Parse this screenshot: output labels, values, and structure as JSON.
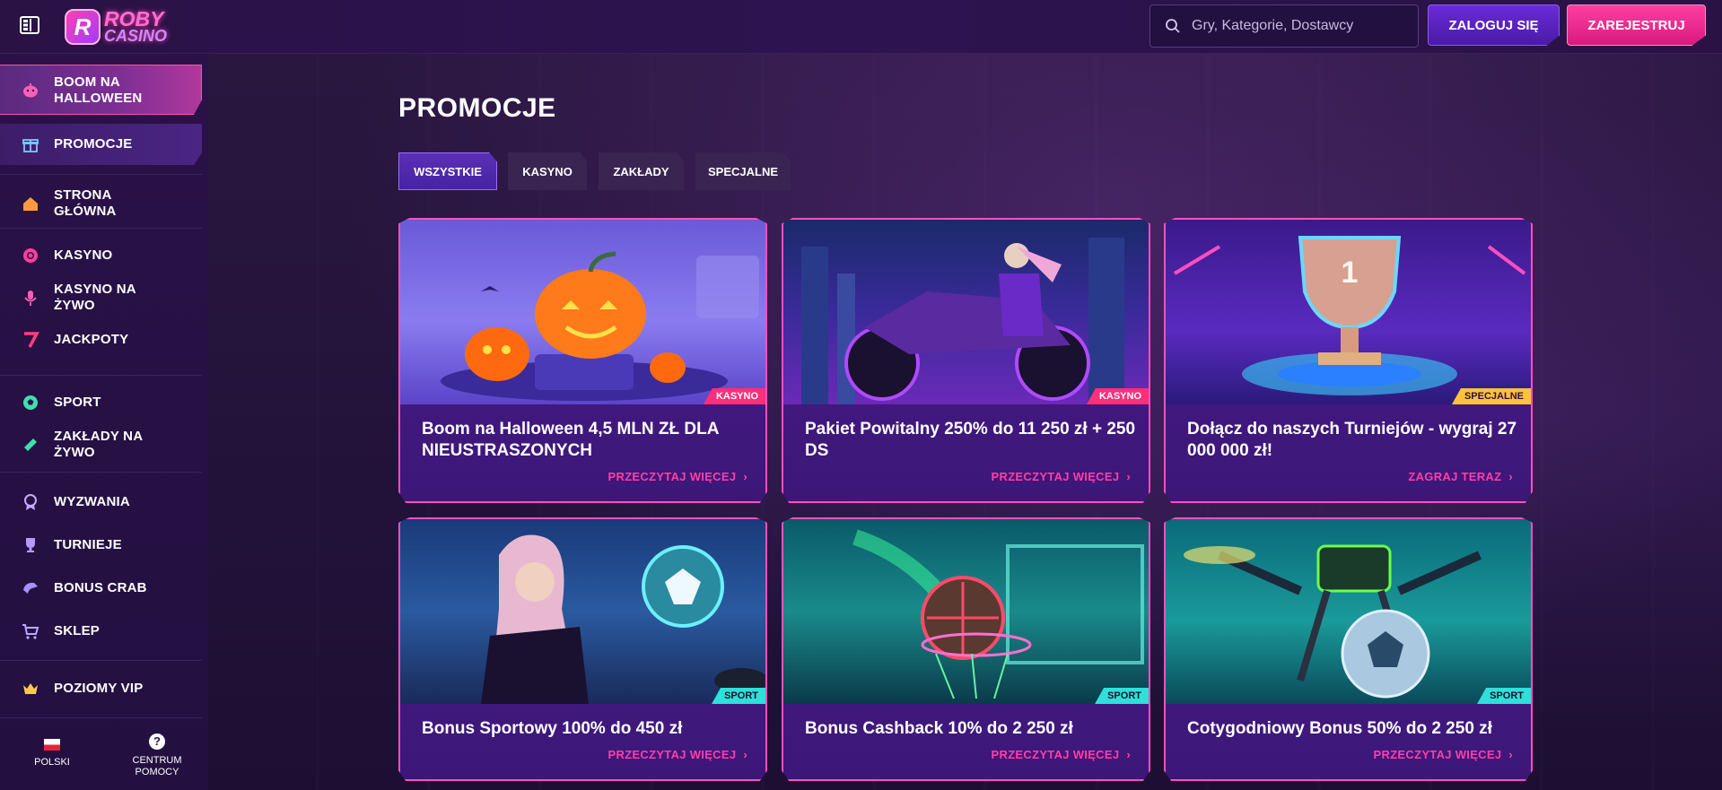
{
  "header": {
    "logo_line1": "ROBY",
    "logo_line2": "CASINO",
    "logo_badge": "R",
    "search_placeholder": "Gry, Kategorie, Dostawcy",
    "login_label": "ZALOGUJ SIĘ",
    "register_label": "ZAREJESTRUJ"
  },
  "sidebar": {
    "items": [
      {
        "label_1": "BOOM NA",
        "label_2": "HALLOWEEN",
        "icon": "pumpkin-icon"
      },
      {
        "label_1": "PROMOCJE",
        "label_2": "",
        "icon": "gift-icon"
      },
      {
        "label_1": "STRONA",
        "label_2": "GŁÓWNA",
        "icon": "home-icon"
      },
      {
        "label_1": "KASYNO",
        "label_2": "",
        "icon": "chip-icon"
      },
      {
        "label_1": "KASYNO NA",
        "label_2": "ŻYWO",
        "icon": "microphone-icon"
      },
      {
        "label_1": "JACKPOTY",
        "label_2": "",
        "icon": "seven-icon"
      },
      {
        "label_1": "SPORT",
        "label_2": "",
        "icon": "soccer-ball-icon"
      },
      {
        "label_1": "ZAKŁADY NA",
        "label_2": "ŻYWO",
        "icon": "ticket-icon"
      },
      {
        "label_1": "WYZWANIA",
        "label_2": "",
        "icon": "badge-icon"
      },
      {
        "label_1": "TURNIEJE",
        "label_2": "",
        "icon": "trophy-icon"
      },
      {
        "label_1": "BONUS CRAB",
        "label_2": "",
        "icon": "claw-icon"
      },
      {
        "label_1": "SKLEP",
        "label_2": "",
        "icon": "cart-icon"
      },
      {
        "label_1": "POZIOMY VIP",
        "label_2": "",
        "icon": "crown-icon"
      }
    ],
    "language_label": "POLSKI",
    "help_label_1": "CENTRUM",
    "help_label_2": "POMOCY",
    "help_icon": "?"
  },
  "main": {
    "title": "PROMOCJE",
    "tabs": [
      "WSZYSTKIE",
      "KASYNO",
      "ZAKŁADY",
      "SPECJALNE"
    ],
    "cards": [
      {
        "title": "Boom na Halloween 4,5 MLN ZŁ DLA NIEUSTRASZONYCH",
        "tag": "KASYNO",
        "link": "PRZECZYTAJ WIĘCEJ"
      },
      {
        "title": "Pakiet Powitalny 250% do 11 250 zł + 250 DS",
        "tag": "KASYNO",
        "link": "PRZECZYTAJ WIĘCEJ"
      },
      {
        "title": "Dołącz do naszych Turniejów - wygraj 27 000 000 zł!",
        "tag": "SPECJALNE",
        "link": "ZAGRAJ TERAZ"
      },
      {
        "title": "Bonus Sportowy 100% do 450 zł",
        "tag": "SPORT",
        "link": "PRZECZYTAJ WIĘCEJ"
      },
      {
        "title": "Bonus Cashback 10% do 2 250 zł",
        "tag": "SPORT",
        "link": "PRZECZYTAJ WIĘCEJ"
      },
      {
        "title": "Cotygodniowy Bonus 50% do 2 250 zł",
        "tag": "SPORT",
        "link": "PRZECZYTAJ WIĘCEJ"
      }
    ]
  },
  "colors": {
    "accent_pink": "#ff3fa6",
    "accent_purple": "#5b2fb8",
    "tag_kasyno": "#ff2f7a",
    "tag_specjalne": "#ffc23a",
    "tag_sport": "#2fe0d8"
  }
}
